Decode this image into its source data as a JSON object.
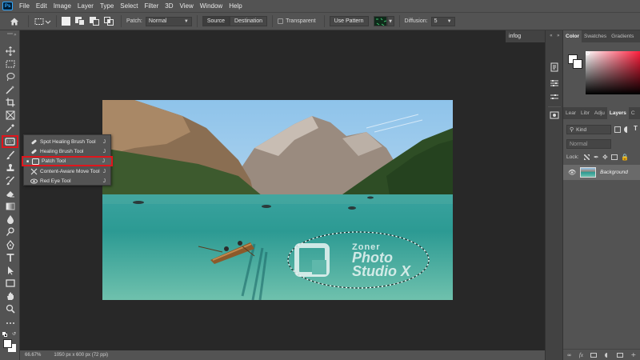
{
  "menubar": {
    "app_logo": "Ps",
    "items": [
      "File",
      "Edit",
      "Image",
      "Layer",
      "Type",
      "Select",
      "Filter",
      "3D",
      "View",
      "Window",
      "Help"
    ]
  },
  "options": {
    "patch_label": "Patch:",
    "patch_mode": "Normal",
    "source_label": "Source",
    "destination_label": "Destination",
    "transparent_label": "Transparent",
    "use_pattern_label": "Use Pattern",
    "diffusion_label": "Diffusion:",
    "diffusion_value": "5"
  },
  "document": {
    "tab_label": "infog"
  },
  "flyout": {
    "items": [
      {
        "label": "Spot Healing Brush Tool",
        "key": "J"
      },
      {
        "label": "Healing Brush Tool",
        "key": "J"
      },
      {
        "label": "Patch Tool",
        "key": "J"
      },
      {
        "label": "Content-Aware Move Tool",
        "key": "J"
      },
      {
        "label": "Red Eye Tool",
        "key": "J"
      }
    ],
    "selected_index": 2
  },
  "status": {
    "zoom": "66.67%",
    "doc_info": "1050 px x 600 px (72 ppi)"
  },
  "color_panel": {
    "tabs": [
      "Color",
      "Swatches",
      "Gradients"
    ],
    "active_tab": "Color"
  },
  "layers_panel": {
    "tabs": [
      "Lear",
      "Libr",
      "Adju",
      "Layers",
      "C"
    ],
    "active_tab": "Layers",
    "search_placeholder": "Kind",
    "blend_mode": "Normal",
    "lock_label": "Lock:",
    "layers": [
      {
        "name": "Background",
        "visible": true
      }
    ]
  },
  "watermark": {
    "line1": "Zoner",
    "line2": "Photo",
    "line3": "Studio X"
  },
  "colors": {
    "highlight": "#e0151c",
    "panel": "#535353",
    "canvas": "#282828"
  }
}
